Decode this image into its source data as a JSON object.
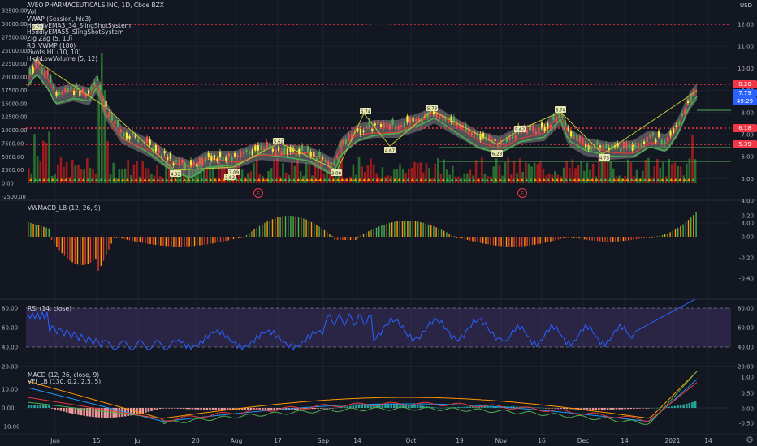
{
  "legend": {
    "symbol": "AVEO PHARMACEUTICALS INC, 1D, Cboe BZX",
    "lines": [
      "Vol",
      "VWAP (Session, hlc3)",
      "HoddlyEMA3_34_SlingShotSystem",
      "HoddlyEMA55_SlingShotSystem",
      "Zig Zag (5, 10)",
      "RB_VWMP (180)",
      "Pivots HL (10, 10)",
      "HighLowVolume (5, 12)"
    ]
  },
  "currency_label": "USD",
  "price_axis": {
    "ticks": [
      "12.00",
      "11.00",
      "10.00",
      "9.00",
      "8.00",
      "7.00",
      "6.00",
      "5.00",
      "4.00",
      "3.00"
    ],
    "tags": [
      {
        "text": "8.20",
        "color": "#f23645"
      },
      {
        "text": "7.79",
        "color": "#2962ff"
      },
      {
        "text": "49:29",
        "color": "#2962ff"
      },
      {
        "text": "6.18",
        "color": "#f23645"
      },
      {
        "text": "5.39",
        "color": "#f23645"
      }
    ]
  },
  "volume_axis": {
    "ticks": [
      "32500.00",
      "30000.00",
      "27500.00",
      "25000.00",
      "22500.00",
      "20000.00",
      "17500.00",
      "15000.00",
      "12500.00",
      "10000.00",
      "7500.00",
      "5000.00",
      "2500.00",
      "0.00",
      "-2500.00"
    ]
  },
  "pivot_labels": [
    "8.70",
    "4.92",
    "2.62",
    "3.09",
    "5.62",
    "3.09",
    "6.74",
    "4.67",
    "5.73",
    "6.28",
    "5.62",
    "4.75",
    "6.74",
    "4.67"
  ],
  "earnings_markers": [
    "E",
    "E"
  ],
  "vwmacd": {
    "label": "VWMACD_LB (12, 26, 9)",
    "ticks": [
      "0.20",
      "0.00",
      "-0.20",
      "-0.40"
    ]
  },
  "rsi": {
    "label": "RSI (14, close)",
    "left_ticks": [
      "80.00",
      "60.00",
      "40.00",
      "20.00"
    ],
    "right_ticks": [
      "80.00",
      "60.00",
      "40.00",
      "20.00"
    ]
  },
  "macd": {
    "label": "MACD (12, 26, close, 9)",
    "label2": "VFI_LB (130, 0.2, 2.5, 5)",
    "left_ticks": [
      "10.00",
      "0.00",
      "-10.00"
    ],
    "right_ticks": [
      "1.00",
      "0.50",
      "0.00",
      "-0.50"
    ]
  },
  "time_axis": [
    "Jun",
    "15",
    "Jul",
    "20",
    "Aug",
    "17",
    "Sep",
    "14",
    "Oct",
    "19",
    "Nov",
    "16",
    "Dec",
    "14",
    "2021",
    "14"
  ],
  "colors": {
    "background": "#131722",
    "bull": "#26a69a",
    "bear": "#ef5350",
    "resistance": "#f23645",
    "rsi_band": "#7e57c2",
    "vwmacd_up": "#4caf50",
    "vwmacd_down": "#ff9800"
  }
}
